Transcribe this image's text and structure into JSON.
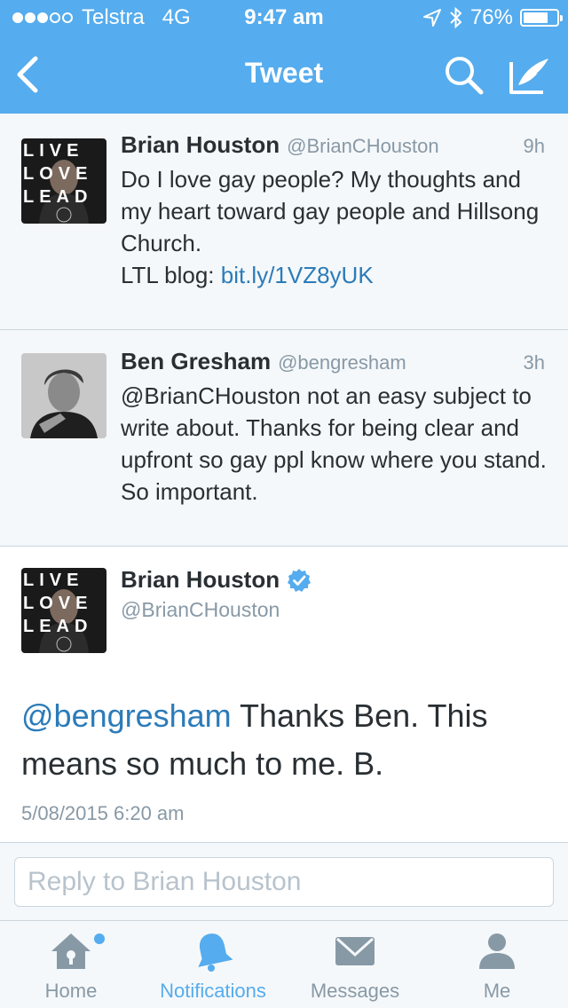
{
  "status_bar": {
    "carrier": "Telstra",
    "network": "4G",
    "time": "9:47 am",
    "battery": "76%",
    "battery_level": 0.76,
    "signal_bars_filled": 3,
    "signal_bars_total": 5
  },
  "nav": {
    "title": "Tweet",
    "back_icon": "chevron-left-icon",
    "search_icon": "search-icon",
    "compose_icon": "compose-icon"
  },
  "tweets": [
    {
      "name": "Brian Houston",
      "handle": "@BrianCHouston",
      "time": "9h",
      "text": "Do I love gay people? My thoughts and my heart toward gay people and Hillsong Church.",
      "blog_prefix": "LTL blog: ",
      "link": "bit.ly/1VZ8yUK"
    },
    {
      "name": "Ben Gresham",
      "handle": "@bengresham",
      "time": "3h",
      "text": "@BrianCHouston not an easy subject to write about. Thanks for being clear and upfront so gay ppl know where you stand. So important."
    }
  ],
  "main_tweet": {
    "name": "Brian Houston",
    "handle": "@BrianCHouston",
    "mention": "@bengresham",
    "text": " Thanks Ben. This means so much to me. B.",
    "timestamp": "5/08/2015 6:20 am"
  },
  "reply": {
    "placeholder": "Reply to Brian Houston"
  },
  "tabs": [
    {
      "label": "Home",
      "icon": "home-icon",
      "active": false,
      "badge": true
    },
    {
      "label": "Notifications",
      "icon": "bell-icon",
      "active": true
    },
    {
      "label": "Messages",
      "icon": "envelope-icon",
      "active": false
    },
    {
      "label": "Me",
      "icon": "person-icon",
      "active": false
    }
  ],
  "avatar_art": {
    "row1": "LIVE",
    "row2": "LOVE",
    "row3": "LEAD",
    "seal": "Hillsong"
  },
  "colors": {
    "brand": "#55acee",
    "link": "#2b7bb9",
    "muted": "#8899a6",
    "text": "#292f33",
    "verified": "#55acee"
  }
}
